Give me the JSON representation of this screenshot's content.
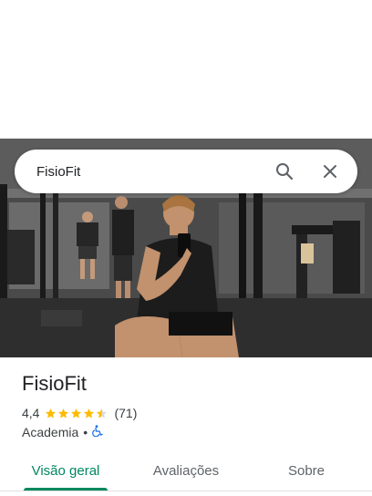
{
  "search": {
    "query": "FisioFit"
  },
  "place": {
    "name": "FisioFit",
    "rating": "4,4",
    "stars": 4.4,
    "review_count": "(71)",
    "category": "Academia",
    "separator": "•",
    "accessibility_icon": "wheelchair-icon"
  },
  "tabs": [
    {
      "label": "Visão geral",
      "active": true
    },
    {
      "label": "Avaliações",
      "active": false
    },
    {
      "label": "Sobre",
      "active": false
    }
  ],
  "colors": {
    "accent": "#01875f",
    "star": "#fbbc04",
    "accessibility": "#1a73e8"
  }
}
